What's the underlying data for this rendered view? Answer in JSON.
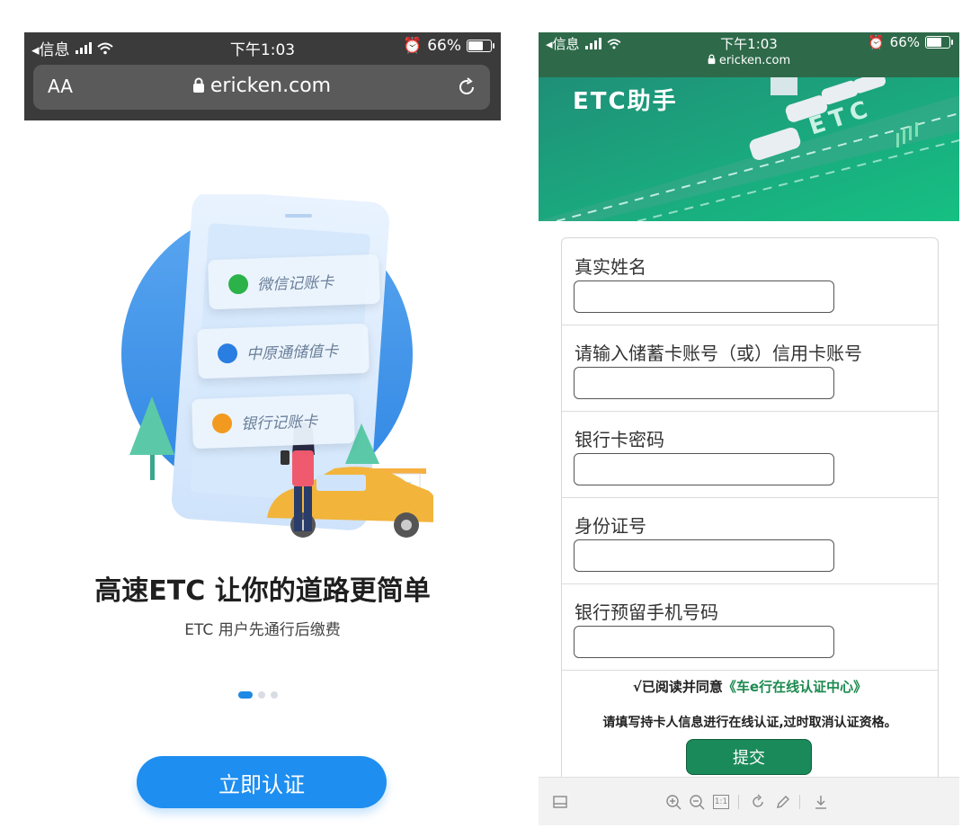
{
  "left_phone": {
    "status_bar": {
      "back_label": "◂信息",
      "time": "下午1:03",
      "battery_percent": "66%",
      "battery_level": 0.66
    },
    "url_bar": {
      "text_size_label": "AA",
      "domain": "ericken.com"
    },
    "illustration": {
      "cards": [
        {
          "label": "微信记账卡",
          "icon": "wechat-icon",
          "color": "#2bb34a"
        },
        {
          "label": "中原通储值卡",
          "icon": "zhongyuantong-icon",
          "color": "#2a7de1"
        },
        {
          "label": "银行记账卡",
          "icon": "bank-icon",
          "color": "#f29a1f"
        }
      ]
    },
    "headline": "高速ETC 让你的道路更简单",
    "subline": "ETC 用户先通行后缴费",
    "pager": {
      "count": 3,
      "active_index": 0
    },
    "cta_label": "立即认证",
    "accent": "#1e8ef0"
  },
  "right_phone": {
    "status_bar": {
      "back_label": "◂信息",
      "time": "下午1:03",
      "battery_percent": "66%",
      "battery_level": 0.66,
      "domain": "ericken.com"
    },
    "banner": {
      "logo_text": "ETC助手",
      "road_text": "ETC",
      "brand_color": "#19b27a"
    },
    "form": {
      "fields": [
        {
          "label": "真实姓名",
          "value": ""
        },
        {
          "label": "请输入储蓄卡账号（或）信用卡账号",
          "value": ""
        },
        {
          "label": "银行卡密码",
          "value": ""
        },
        {
          "label": "身份证号",
          "value": ""
        },
        {
          "label": "银行预留手机号码",
          "value": ""
        }
      ],
      "agree_prefix": "√已阅读并同意",
      "agree_link": "《车e行在线认证中心》",
      "notice": "请填写持卡人信息进行在线认证,过时取消认证资格。",
      "submit_label": "提交"
    },
    "pdf_toolbar": {
      "icons": [
        "sidebar-icon",
        "zoom-in-icon",
        "zoom-out-icon",
        "actual-size-icon",
        "rotate-icon",
        "annotate-icon",
        "download-icon"
      ],
      "actual_size_label": "1:1"
    }
  }
}
